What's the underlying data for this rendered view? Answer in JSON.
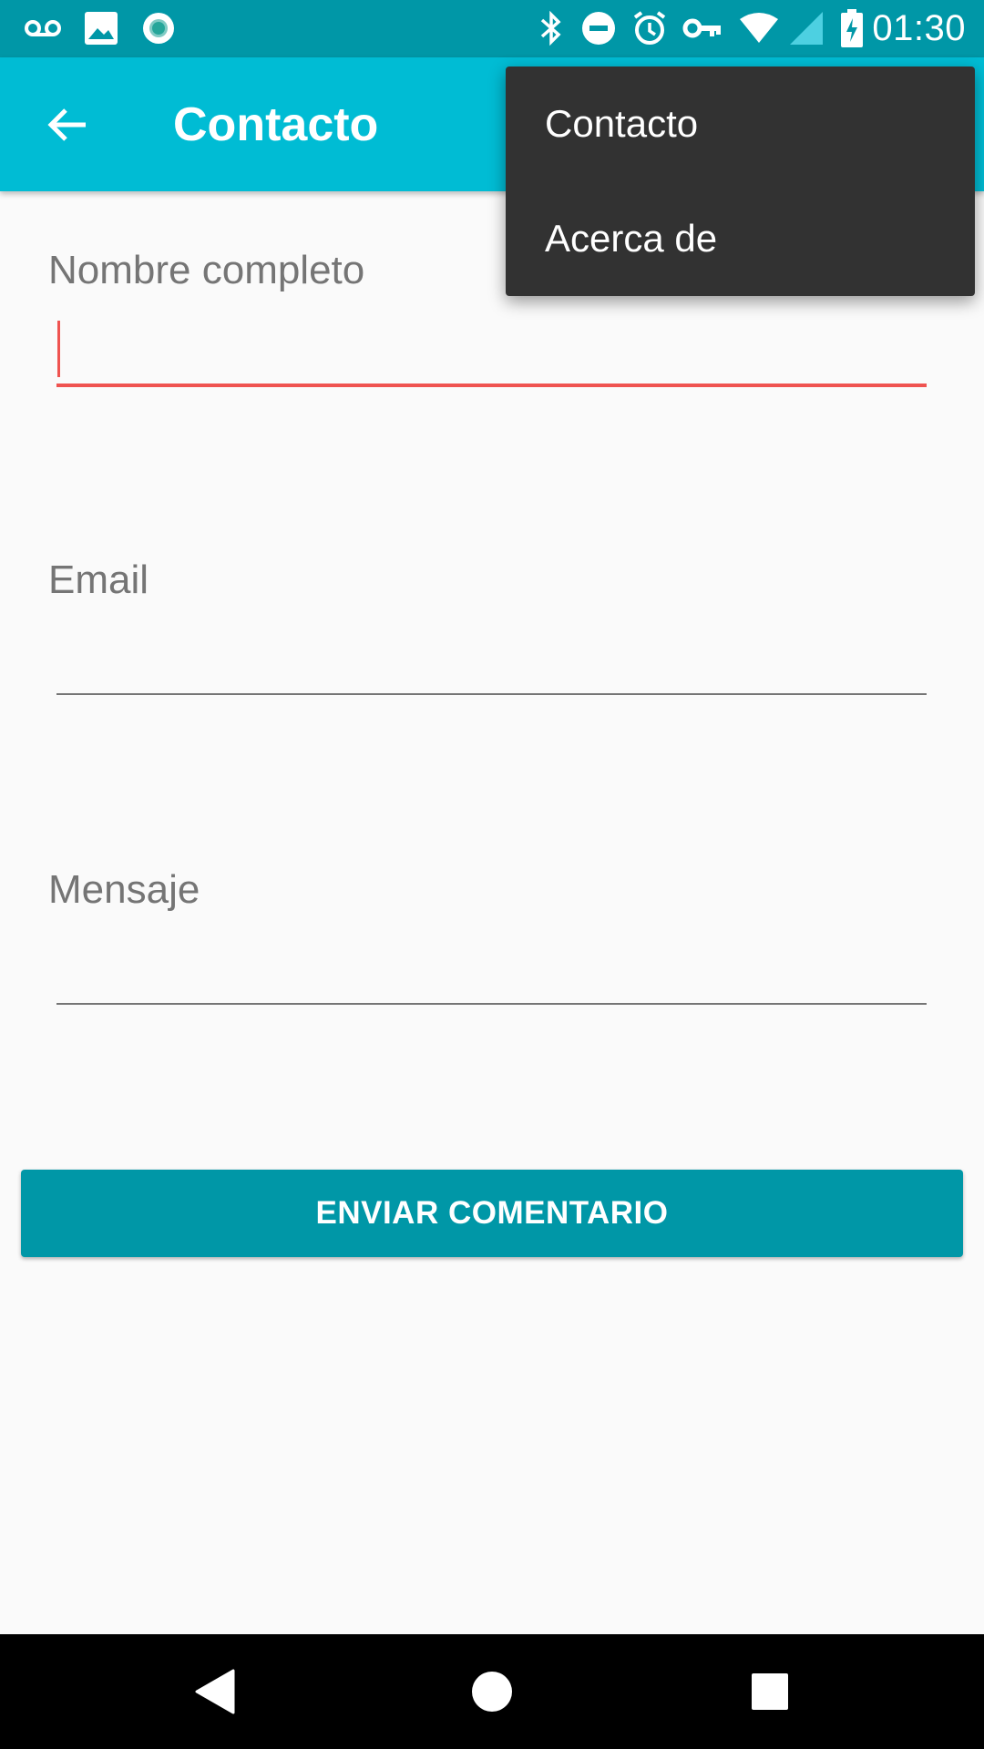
{
  "status_bar": {
    "time": "01:30",
    "left_icons": [
      "voicemail-icon",
      "image-icon",
      "sync-icon"
    ],
    "right_icons": [
      "bluetooth-icon",
      "do-not-disturb-icon",
      "alarm-icon",
      "vpn-key-icon",
      "wifi-icon",
      "cell-signal-icon",
      "battery-charging-icon"
    ]
  },
  "app_bar": {
    "title": "Contacto",
    "back_icon": "arrow-back-icon"
  },
  "form": {
    "name_label": "Nombre completo",
    "email_label": "Email",
    "message_label": "Mensaje",
    "submit_label": "ENVIAR COMENTARIO"
  },
  "overflow_menu": {
    "items": [
      {
        "label": "Contacto"
      },
      {
        "label": "Acerca de"
      }
    ]
  },
  "colors": {
    "status_bar": "#0097a7",
    "app_bar": "#00bcd4",
    "button": "#0097a7",
    "focus_accent": "#ef5350",
    "menu_bg": "#323232"
  },
  "nav_bar": {
    "icons": [
      "back-nav-icon",
      "home-nav-icon",
      "recents-nav-icon"
    ]
  }
}
